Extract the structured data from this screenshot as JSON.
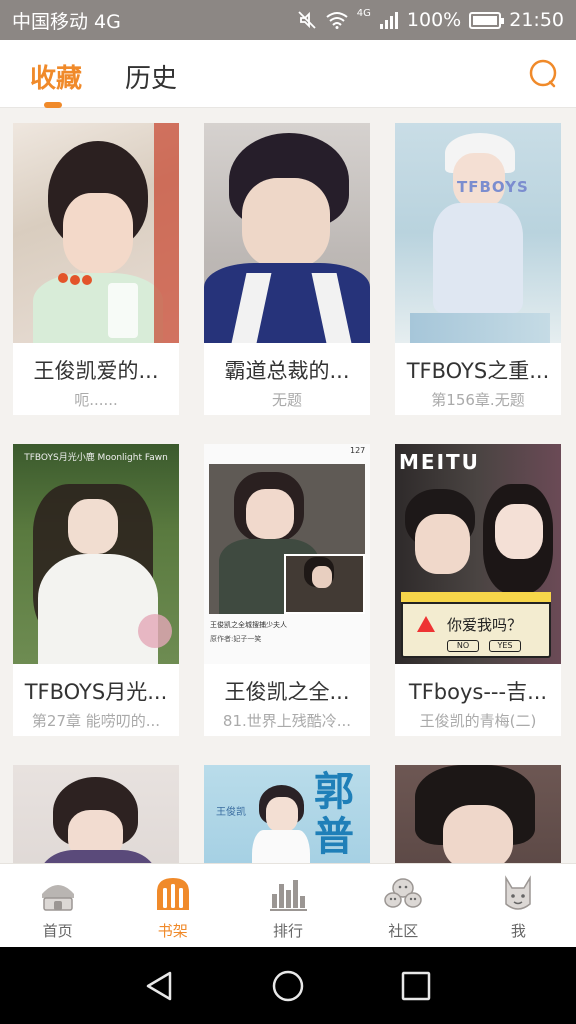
{
  "status_bar": {
    "carrier": "中国移动 4G",
    "network": "4G",
    "battery": "100%",
    "time": "21:50",
    "battery_level": 1.0
  },
  "header": {
    "tabs": [
      {
        "label": "收藏",
        "active": true
      },
      {
        "label": "历史",
        "active": false
      }
    ],
    "search_icon": "search-icon",
    "accent_color": "#f08a2a"
  },
  "books": [
    {
      "title": "王俊凯爱的...",
      "subtitle": "呃......"
    },
    {
      "title": "霸道总裁的...",
      "subtitle": "无题"
    },
    {
      "title": "TFBOYS之重...",
      "subtitle": "第156章.无题",
      "cover_text": "TFBOYS"
    },
    {
      "title": "TFBOYS月光...",
      "subtitle": "第27章 能唠叨的...",
      "cover_text": "TFBOYS月光小鹿 Moonlight Fawn"
    },
    {
      "title": "王俊凯之全...",
      "subtitle": "81.世界上残酷冷...",
      "cover_text": "王俊凯之全城搜捕少夫人",
      "cover_author": "原作者:妃子一笑"
    },
    {
      "title": "TFboys---吉...",
      "subtitle": "王俊凯的青梅(二)",
      "cover_text": "MEITU",
      "cover_dialog": "你爱我吗？",
      "cover_no": "NO",
      "cover_yes": "YES"
    },
    {
      "title": "",
      "subtitle": ""
    },
    {
      "title": "",
      "subtitle": "",
      "cover_text": "王俊凯"
    },
    {
      "title": "",
      "subtitle": ""
    }
  ],
  "bottom_nav": [
    {
      "label": "首页",
      "icon": "home-icon",
      "active": false
    },
    {
      "label": "书架",
      "icon": "bookshelf-icon",
      "active": true
    },
    {
      "label": "排行",
      "icon": "ranking-icon",
      "active": false
    },
    {
      "label": "社区",
      "icon": "community-icon",
      "active": false
    },
    {
      "label": "我",
      "icon": "profile-icon",
      "active": false
    }
  ],
  "system_nav": [
    "back-icon",
    "home-circle-icon",
    "recents-icon"
  ]
}
